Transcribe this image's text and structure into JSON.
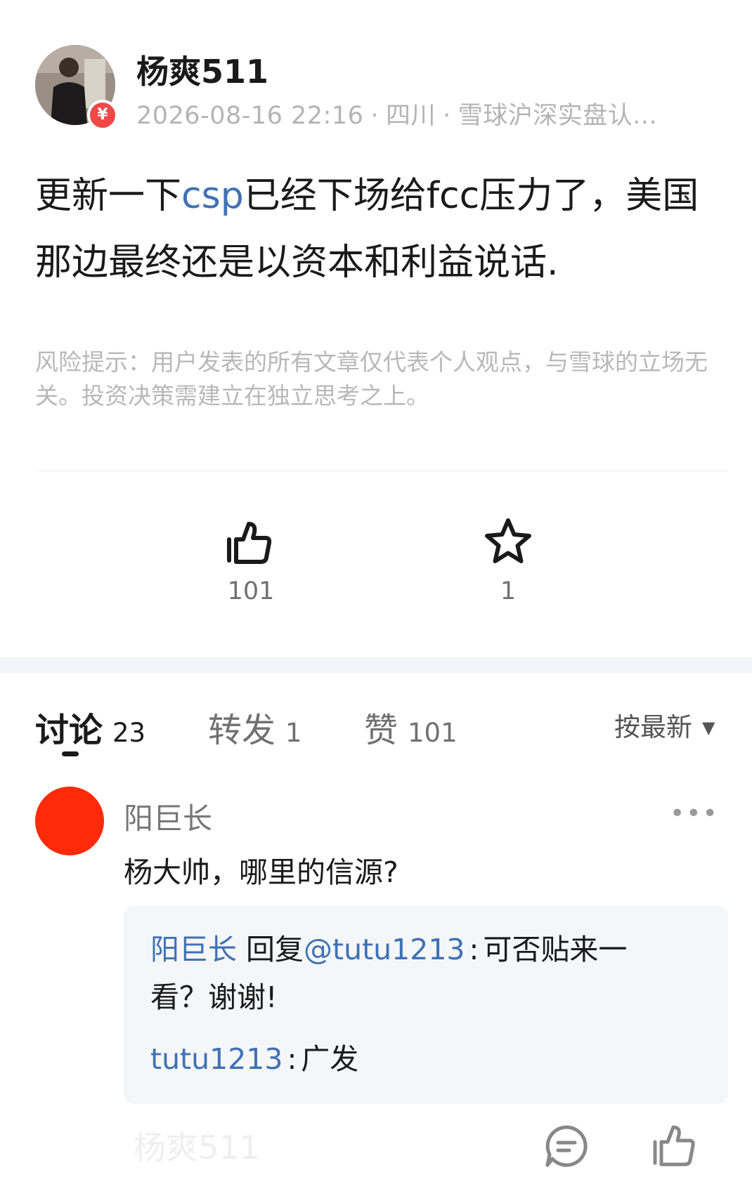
{
  "header": {
    "username": "杨爽511",
    "time": "2026-08-16 22:16",
    "location": "四川",
    "verification": "雪球沪深实盘认...",
    "separator": "·",
    "badge": "¥"
  },
  "post": {
    "text_before_link": "更新一下",
    "link": "csp",
    "text_after_link": "已经下场给fcc压力了，美国那边最终还是以资本和利益说话.",
    "risk_notice": "风险提示：用户发表的所有文章仅代表个人观点，与雪球的立场无关。投资决策需建立在独立思考之上。"
  },
  "actions": {
    "like_count": "101",
    "favorite_count": "1",
    "icons": [
      "thumbs-up-icon",
      "star-icon"
    ]
  },
  "tabs": [
    {
      "label": "讨论",
      "count": "23",
      "active": true
    },
    {
      "label": "转发",
      "count": "1",
      "active": false
    },
    {
      "label": "赞",
      "count": "101",
      "active": false
    }
  ],
  "sort": {
    "label": "按最新",
    "caret": "▼"
  },
  "comment": {
    "author": "阳巨长",
    "text": "杨大帅，哪里的信源?",
    "more": "•••",
    "avatar_color": "#fe2a0a",
    "replies": [
      {
        "author": "阳巨长",
        "verb": "回复",
        "mention": "@tutu1213",
        "text": "可否贴来一看？谢谢!"
      },
      {
        "author": "tutu1213",
        "text": "广发"
      }
    ]
  },
  "bottom": {
    "faded_text": "杨爽511"
  },
  "colors": {
    "link": "#3f72b4",
    "muted": "#b4b4b4",
    "badge": "#f04848"
  }
}
